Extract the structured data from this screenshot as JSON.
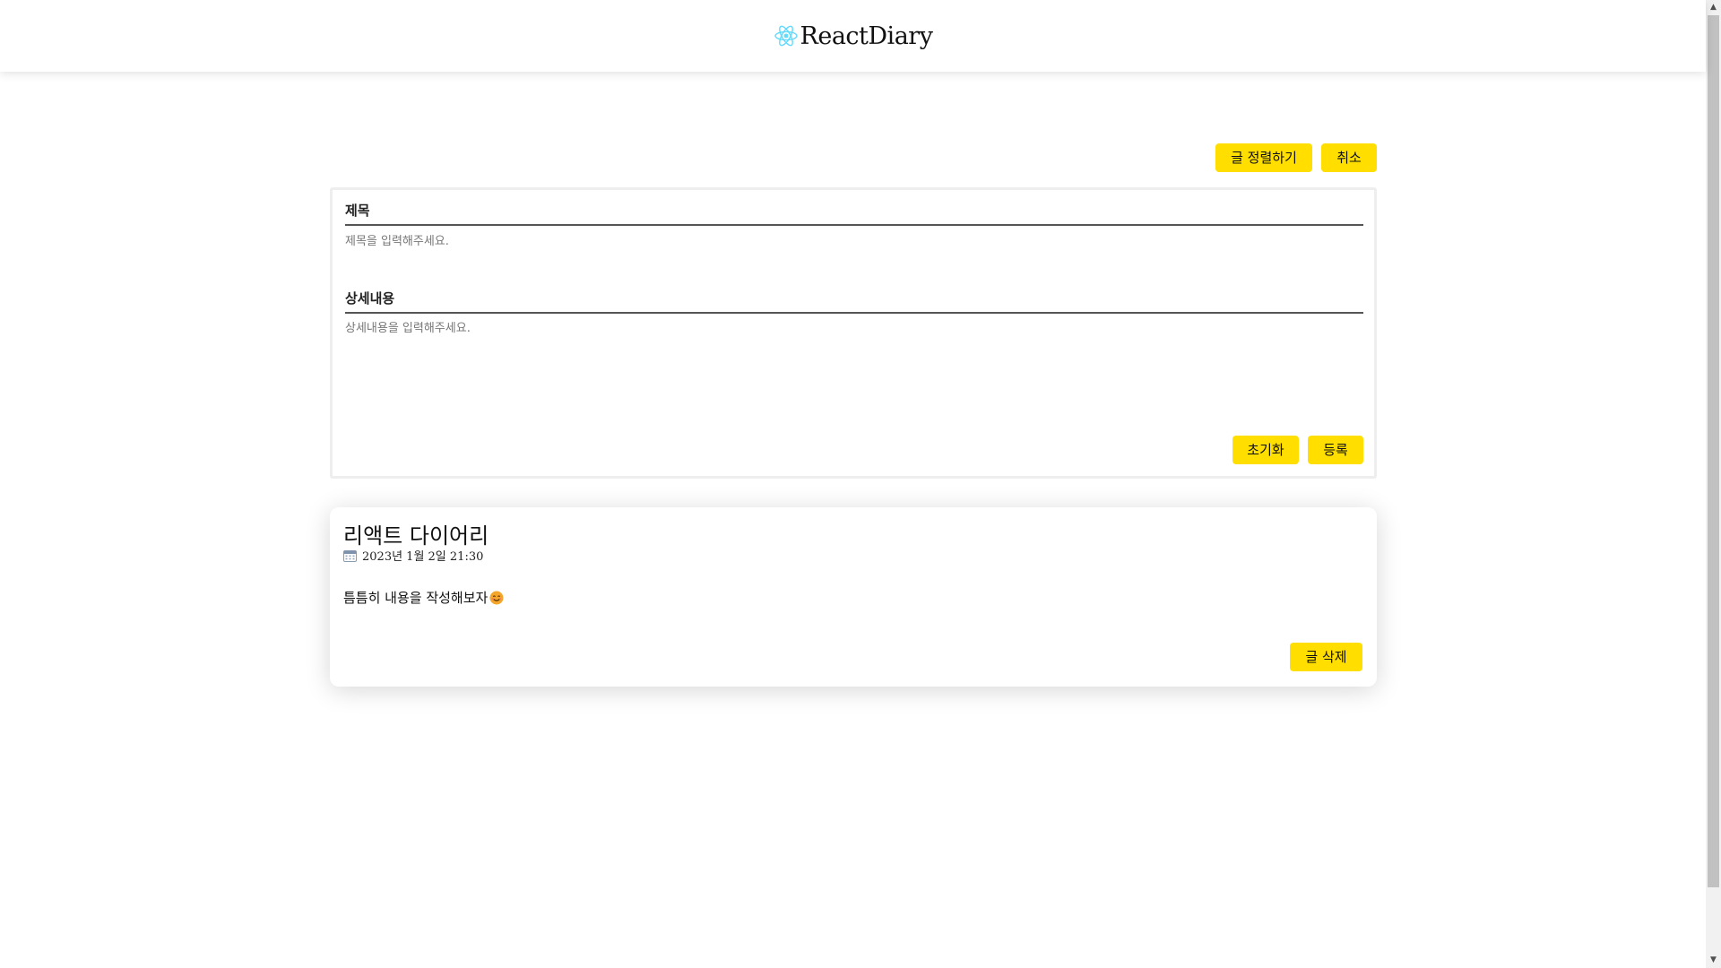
{
  "header": {
    "logo_text": "ReactDiary",
    "logo_icon": "react-atom-icon",
    "brand_color": "#61dafb"
  },
  "toolbar": {
    "sort_label": "글 정렬하기",
    "cancel_label": "취소"
  },
  "form": {
    "title_label": "제목",
    "title_placeholder": "제목을 입력해주세요.",
    "title_value": "",
    "content_label": "상세내용",
    "content_placeholder": "상세내용을 입력해주세요.",
    "content_value": "",
    "reset_label": "초기화",
    "submit_label": "등록"
  },
  "posts": [
    {
      "title": "리액트 다이어리",
      "date_icon": "calendar-icon",
      "date": "2023년 1월 2일 21:30",
      "body": "틈틈히 내용을 작성해보자",
      "body_emoji": "smiling-face-icon",
      "delete_label": "글 삭제"
    }
  ],
  "colors": {
    "accent": "#ffde00",
    "text": "#111111",
    "form_border": "#eeeeee"
  }
}
